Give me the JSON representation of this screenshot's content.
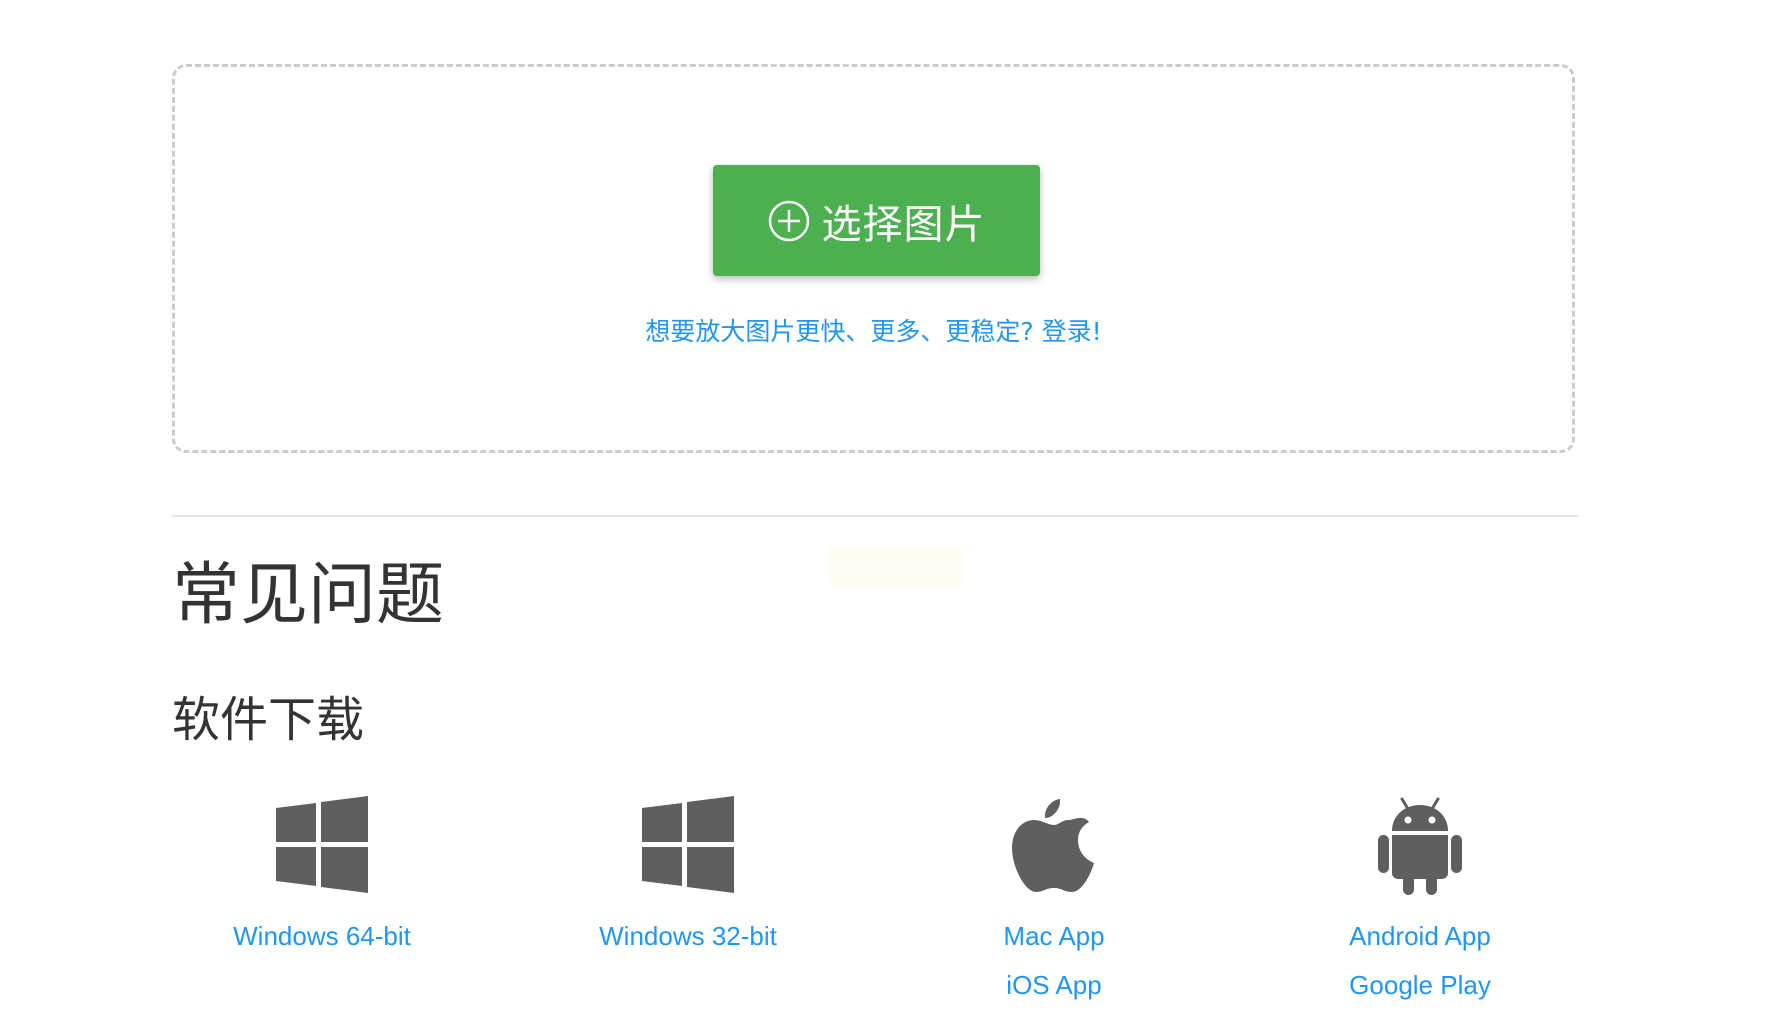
{
  "upload": {
    "select_button_label": "选择图片",
    "login_prompt": "想要放大图片更快、更多、更稳定? 登录!"
  },
  "faq": {
    "title": "常见问题"
  },
  "downloads": {
    "title": "软件下载",
    "items": [
      {
        "icon": "windows-icon",
        "links": [
          "Windows 64-bit"
        ]
      },
      {
        "icon": "windows-icon",
        "links": [
          "Windows 32-bit"
        ]
      },
      {
        "icon": "apple-icon",
        "links": [
          "Mac App",
          "iOS App"
        ]
      },
      {
        "icon": "android-icon",
        "links": [
          "Android App",
          "Google Play"
        ]
      }
    ]
  },
  "colors": {
    "accent_green": "#4caf50",
    "link_blue": "#2196f3",
    "icon_gray": "#5f5f5f",
    "text_dark": "#333333",
    "dashed_border": "#cccccc"
  }
}
